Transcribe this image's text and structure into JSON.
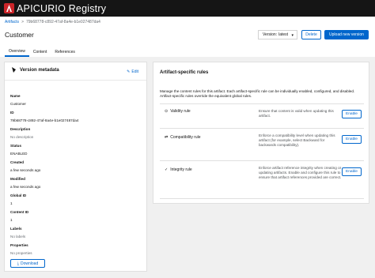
{
  "app": {
    "brand": "APICURIO Registry"
  },
  "breadcrumb": {
    "root": "Artifacts",
    "separator": ">",
    "current": "79b68778-c892-47af-8a4e-b1e027487da4"
  },
  "page": {
    "title": "Customer"
  },
  "version_select": {
    "label": "Version:",
    "value": "latest"
  },
  "buttons": {
    "delete": "Delete",
    "upload": "Upload new version",
    "edit": "Edit",
    "download": "Download"
  },
  "tabs": [
    {
      "label": "Overview"
    },
    {
      "label": "Content"
    },
    {
      "label": "References"
    }
  ],
  "metadata": {
    "title": "Version metadata",
    "fields": [
      {
        "key": "Name",
        "value": "Customer"
      },
      {
        "key": "ID",
        "value": "79b68778-c892-47af-8a4e-b1e027487da4"
      },
      {
        "key": "Description",
        "value": "No description"
      },
      {
        "key": "Status",
        "value": "ENABLED"
      },
      {
        "key": "Created",
        "value": "a few seconds ago"
      },
      {
        "key": "Modified",
        "value": "a few seconds ago"
      },
      {
        "key": "Global ID",
        "value": "1"
      },
      {
        "key": "Content ID",
        "value": "1"
      },
      {
        "key": "Labels",
        "value": "No labels"
      },
      {
        "key": "Properties",
        "value": "No properties"
      }
    ]
  },
  "rules": {
    "title": "Artifact-specific rules",
    "description": "Manage the content rules for this artifact. Each artifact-specific rule can be individually enabled, configured, and disabled. Artifact-specific rules override the equivalent global rules.",
    "items": [
      {
        "name": "Validity rule",
        "icon": "check-circle-icon",
        "description": "Ensure that content is valid when updating this artifact.",
        "action": "Enable"
      },
      {
        "name": "Compatibility rule",
        "icon": "sync-icon",
        "description": "Enforce a compatibility level when updating this artifact (for example, select Backward for backwards compatibility).",
        "action": "Enable"
      },
      {
        "name": "Integrity rule",
        "icon": "check-icon",
        "description": "Enforce artifact reference integrity when creating or updating artifacts. Enable and configure this rule to ensure that artifact references provided are correct.",
        "action": "Enable"
      }
    ]
  },
  "colors": {
    "accent": "#0066cc",
    "topbar": "#151515",
    "logo_red": "#cc2529"
  }
}
